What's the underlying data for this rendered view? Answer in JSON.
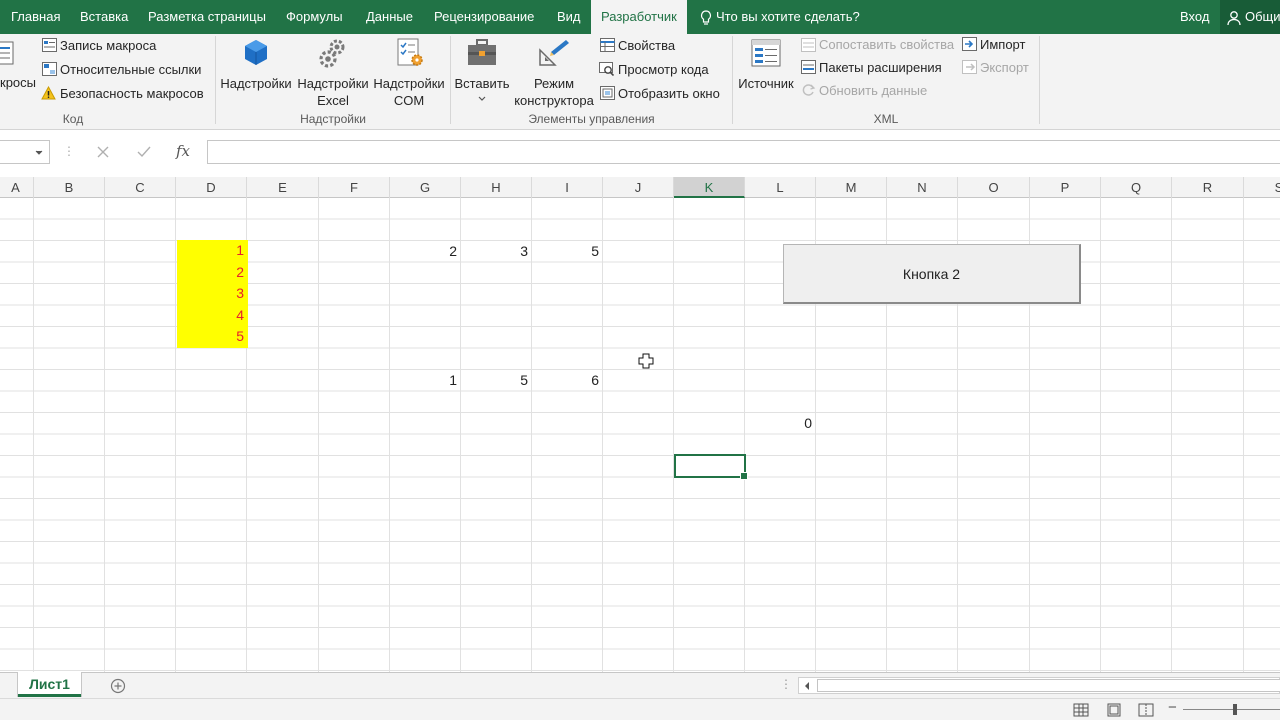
{
  "tabs": [
    {
      "label": "Главная"
    },
    {
      "label": "Вставка"
    },
    {
      "label": "Разметка страницы"
    },
    {
      "label": "Формулы"
    },
    {
      "label": "Данные"
    },
    {
      "label": "Рецензирование"
    },
    {
      "label": "Вид"
    },
    {
      "label": "Разработчик"
    }
  ],
  "tell_me": "Что вы хотите сделать?",
  "sign_in": "Вход",
  "share": "Общий доступ",
  "ribbon": {
    "code": {
      "macros_label": "кросы",
      "record_macro": "Запись макроса",
      "relative_refs": "Относительные ссылки",
      "macro_security": "Безопасность макросов",
      "group_label": "Код"
    },
    "addins": {
      "addins": "Надстройки",
      "excel_addins_1": "Надстройки",
      "excel_addins_2": "Excel",
      "com_addins_1": "Надстройки",
      "com_addins_2": "COM",
      "group_label": "Надстройки"
    },
    "controls": {
      "insert": "Вставить",
      "design_mode_1": "Режим",
      "design_mode_2": "конструктора",
      "properties": "Свойства",
      "view_code": "Просмотр кода",
      "run_dialog": "Отобразить окно",
      "group_label": "Элементы управления"
    },
    "xml": {
      "source": "Источник",
      "map_properties": "Сопоставить свойства",
      "expansion_packs": "Пакеты расширения",
      "refresh_data": "Обновить данные",
      "import": "Импорт",
      "export": "Экспорт",
      "group_label": "XML"
    }
  },
  "formula_bar": {
    "fx": "fx",
    "formula": ""
  },
  "columns": [
    "A",
    "B",
    "C",
    "D",
    "E",
    "F",
    "G",
    "H",
    "I",
    "J",
    "K",
    "L",
    "M",
    "N",
    "O",
    "P",
    "Q",
    "R",
    "S"
  ],
  "selected_column": "K",
  "cells": {
    "d_values": [
      "1",
      "2",
      "3",
      "4",
      "5"
    ],
    "row4": [
      "2",
      "3",
      "5"
    ],
    "row10": [
      "1",
      "5",
      "6"
    ],
    "l12": "0"
  },
  "button2_label": "Кнопка 2",
  "sheet_tab": "Лист1",
  "colors": {
    "accent": "#217346",
    "highlight": "#ffff00",
    "highlight_text": "#e8202a"
  }
}
